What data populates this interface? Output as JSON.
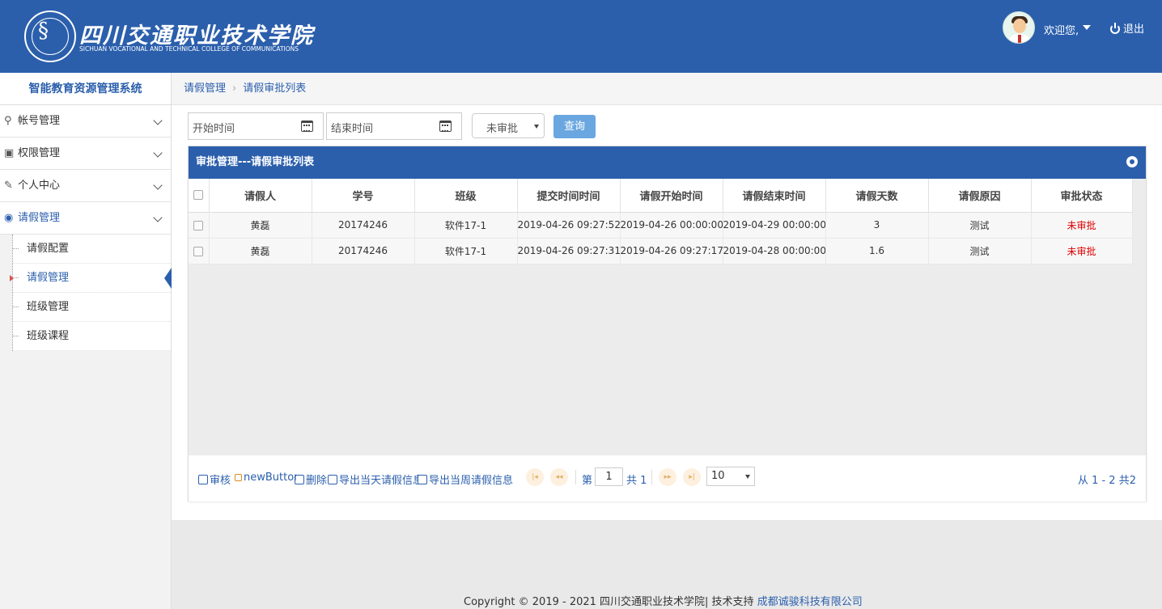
{
  "header": {
    "school_name_cn": "四川交通职业技术学院",
    "school_name_en": "SICHUAN VOCATIONAL AND TECHNICAL COLLEGE OF COMMUNICATIONS",
    "welcome": "欢迎您,",
    "logout": "退出",
    "brand_color": "#2b5fac"
  },
  "sidebar": {
    "title": "智能教育资源管理系统",
    "menus": [
      {
        "label": "帐号管理",
        "icon": "user-icon"
      },
      {
        "label": "权限管理",
        "icon": "lock-icon"
      },
      {
        "label": "个人中心",
        "icon": "pencil-icon"
      },
      {
        "label": "请假管理",
        "icon": "leave-icon"
      }
    ],
    "submenu": [
      {
        "label": "请假配置"
      },
      {
        "label": "请假管理"
      },
      {
        "label": "班级管理"
      },
      {
        "label": "班级课程"
      }
    ]
  },
  "breadcrumb": {
    "items": [
      "请假管理",
      "请假审批列表"
    ]
  },
  "filters": {
    "start_placeholder": "开始时间",
    "end_placeholder": "结束时间",
    "status_selected": "未审批",
    "query_button": "查询"
  },
  "panel": {
    "title": "审批管理---请假审批列表",
    "columns": [
      "请假人",
      "学号",
      "班级",
      "提交时间时间",
      "请假开始时间",
      "请假结束时间",
      "请假天数",
      "请假原因",
      "审批状态"
    ],
    "rows": [
      [
        "黄磊",
        "20174246",
        "软件17-1",
        "2019-04-26 09:27:52",
        "2019-04-26 00:00:00",
        "2019-04-29 00:00:00",
        "3",
        "测试",
        "未审批"
      ],
      [
        "黄磊",
        "20174246",
        "软件17-1",
        "2019-04-26 09:27:31",
        "2019-04-26 09:27:17",
        "2019-04-28 00:00:00",
        "1.6",
        "测试",
        "未审批"
      ]
    ],
    "status_color": "#e00000"
  },
  "pager": {
    "actions": [
      "审核",
      "newButton",
      "删除",
      "导出当天请假信息",
      "导出当周请假信息"
    ],
    "page_prefix": "第",
    "page_value": "1",
    "page_total": "共 1",
    "page_size": "10",
    "summary": "从 1 - 2 共2"
  },
  "footer": {
    "copyright": "Copyright © 2019 - 2021 四川交通职业技术学院| 技术支持",
    "support_link": "成都诚骏科技有限公司"
  }
}
